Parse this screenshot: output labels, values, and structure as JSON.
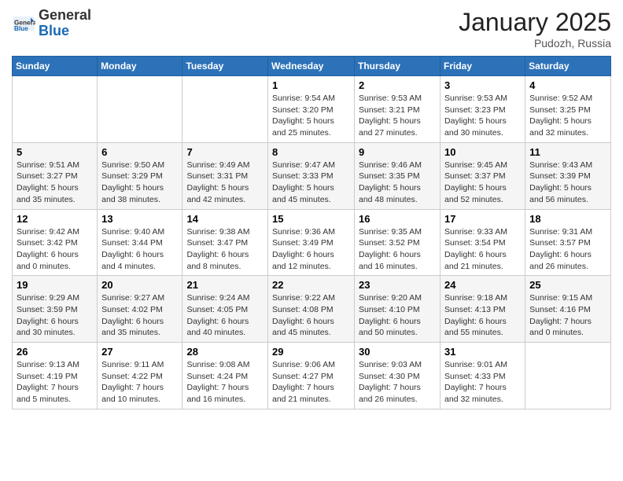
{
  "header": {
    "logo_general": "General",
    "logo_blue": "Blue",
    "month_title": "January 2025",
    "location": "Pudozh, Russia"
  },
  "weekdays": [
    "Sunday",
    "Monday",
    "Tuesday",
    "Wednesday",
    "Thursday",
    "Friday",
    "Saturday"
  ],
  "weeks": [
    [
      {
        "day": "",
        "info": ""
      },
      {
        "day": "",
        "info": ""
      },
      {
        "day": "",
        "info": ""
      },
      {
        "day": "1",
        "info": "Sunrise: 9:54 AM\nSunset: 3:20 PM\nDaylight: 5 hours and 25 minutes."
      },
      {
        "day": "2",
        "info": "Sunrise: 9:53 AM\nSunset: 3:21 PM\nDaylight: 5 hours and 27 minutes."
      },
      {
        "day": "3",
        "info": "Sunrise: 9:53 AM\nSunset: 3:23 PM\nDaylight: 5 hours and 30 minutes."
      },
      {
        "day": "4",
        "info": "Sunrise: 9:52 AM\nSunset: 3:25 PM\nDaylight: 5 hours and 32 minutes."
      }
    ],
    [
      {
        "day": "5",
        "info": "Sunrise: 9:51 AM\nSunset: 3:27 PM\nDaylight: 5 hours and 35 minutes."
      },
      {
        "day": "6",
        "info": "Sunrise: 9:50 AM\nSunset: 3:29 PM\nDaylight: 5 hours and 38 minutes."
      },
      {
        "day": "7",
        "info": "Sunrise: 9:49 AM\nSunset: 3:31 PM\nDaylight: 5 hours and 42 minutes."
      },
      {
        "day": "8",
        "info": "Sunrise: 9:47 AM\nSunset: 3:33 PM\nDaylight: 5 hours and 45 minutes."
      },
      {
        "day": "9",
        "info": "Sunrise: 9:46 AM\nSunset: 3:35 PM\nDaylight: 5 hours and 48 minutes."
      },
      {
        "day": "10",
        "info": "Sunrise: 9:45 AM\nSunset: 3:37 PM\nDaylight: 5 hours and 52 minutes."
      },
      {
        "day": "11",
        "info": "Sunrise: 9:43 AM\nSunset: 3:39 PM\nDaylight: 5 hours and 56 minutes."
      }
    ],
    [
      {
        "day": "12",
        "info": "Sunrise: 9:42 AM\nSunset: 3:42 PM\nDaylight: 6 hours and 0 minutes."
      },
      {
        "day": "13",
        "info": "Sunrise: 9:40 AM\nSunset: 3:44 PM\nDaylight: 6 hours and 4 minutes."
      },
      {
        "day": "14",
        "info": "Sunrise: 9:38 AM\nSunset: 3:47 PM\nDaylight: 6 hours and 8 minutes."
      },
      {
        "day": "15",
        "info": "Sunrise: 9:36 AM\nSunset: 3:49 PM\nDaylight: 6 hours and 12 minutes."
      },
      {
        "day": "16",
        "info": "Sunrise: 9:35 AM\nSunset: 3:52 PM\nDaylight: 6 hours and 16 minutes."
      },
      {
        "day": "17",
        "info": "Sunrise: 9:33 AM\nSunset: 3:54 PM\nDaylight: 6 hours and 21 minutes."
      },
      {
        "day": "18",
        "info": "Sunrise: 9:31 AM\nSunset: 3:57 PM\nDaylight: 6 hours and 26 minutes."
      }
    ],
    [
      {
        "day": "19",
        "info": "Sunrise: 9:29 AM\nSunset: 3:59 PM\nDaylight: 6 hours and 30 minutes."
      },
      {
        "day": "20",
        "info": "Sunrise: 9:27 AM\nSunset: 4:02 PM\nDaylight: 6 hours and 35 minutes."
      },
      {
        "day": "21",
        "info": "Sunrise: 9:24 AM\nSunset: 4:05 PM\nDaylight: 6 hours and 40 minutes."
      },
      {
        "day": "22",
        "info": "Sunrise: 9:22 AM\nSunset: 4:08 PM\nDaylight: 6 hours and 45 minutes."
      },
      {
        "day": "23",
        "info": "Sunrise: 9:20 AM\nSunset: 4:10 PM\nDaylight: 6 hours and 50 minutes."
      },
      {
        "day": "24",
        "info": "Sunrise: 9:18 AM\nSunset: 4:13 PM\nDaylight: 6 hours and 55 minutes."
      },
      {
        "day": "25",
        "info": "Sunrise: 9:15 AM\nSunset: 4:16 PM\nDaylight: 7 hours and 0 minutes."
      }
    ],
    [
      {
        "day": "26",
        "info": "Sunrise: 9:13 AM\nSunset: 4:19 PM\nDaylight: 7 hours and 5 minutes."
      },
      {
        "day": "27",
        "info": "Sunrise: 9:11 AM\nSunset: 4:22 PM\nDaylight: 7 hours and 10 minutes."
      },
      {
        "day": "28",
        "info": "Sunrise: 9:08 AM\nSunset: 4:24 PM\nDaylight: 7 hours and 16 minutes."
      },
      {
        "day": "29",
        "info": "Sunrise: 9:06 AM\nSunset: 4:27 PM\nDaylight: 7 hours and 21 minutes."
      },
      {
        "day": "30",
        "info": "Sunrise: 9:03 AM\nSunset: 4:30 PM\nDaylight: 7 hours and 26 minutes."
      },
      {
        "day": "31",
        "info": "Sunrise: 9:01 AM\nSunset: 4:33 PM\nDaylight: 7 hours and 32 minutes."
      },
      {
        "day": "",
        "info": ""
      }
    ]
  ]
}
